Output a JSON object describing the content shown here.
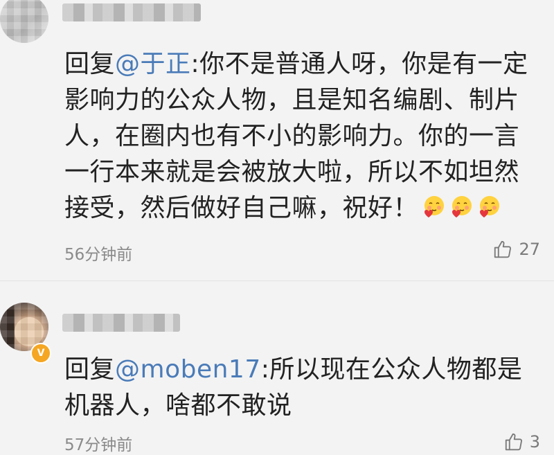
{
  "comments": [
    {
      "prefix": "回复",
      "mention": "@于正",
      "body": ":你不是普通人呀，你是有一定影响力的公众人物，且是知名编剧、制片人，在圈内也有不小的影响力。你的一言一行本来就是会被放大啦，所以不如坦然接受，然后做好自己嘛，祝好！",
      "emojis": [
        "blush-heart-emoji",
        "blush-heart-emoji",
        "blush-heart-emoji"
      ],
      "time": "56分钟前",
      "likes": "27"
    },
    {
      "prefix": "回复",
      "mention": "@moben17",
      "body": ":所以现在公众人物都是机器人，啥都不敢说",
      "time": "57分钟前",
      "likes": "3",
      "verified_badge": "V"
    }
  ],
  "colors": {
    "mention": "#4a7bb8",
    "badge": "#f5a623",
    "background": "#f3f3f3"
  }
}
